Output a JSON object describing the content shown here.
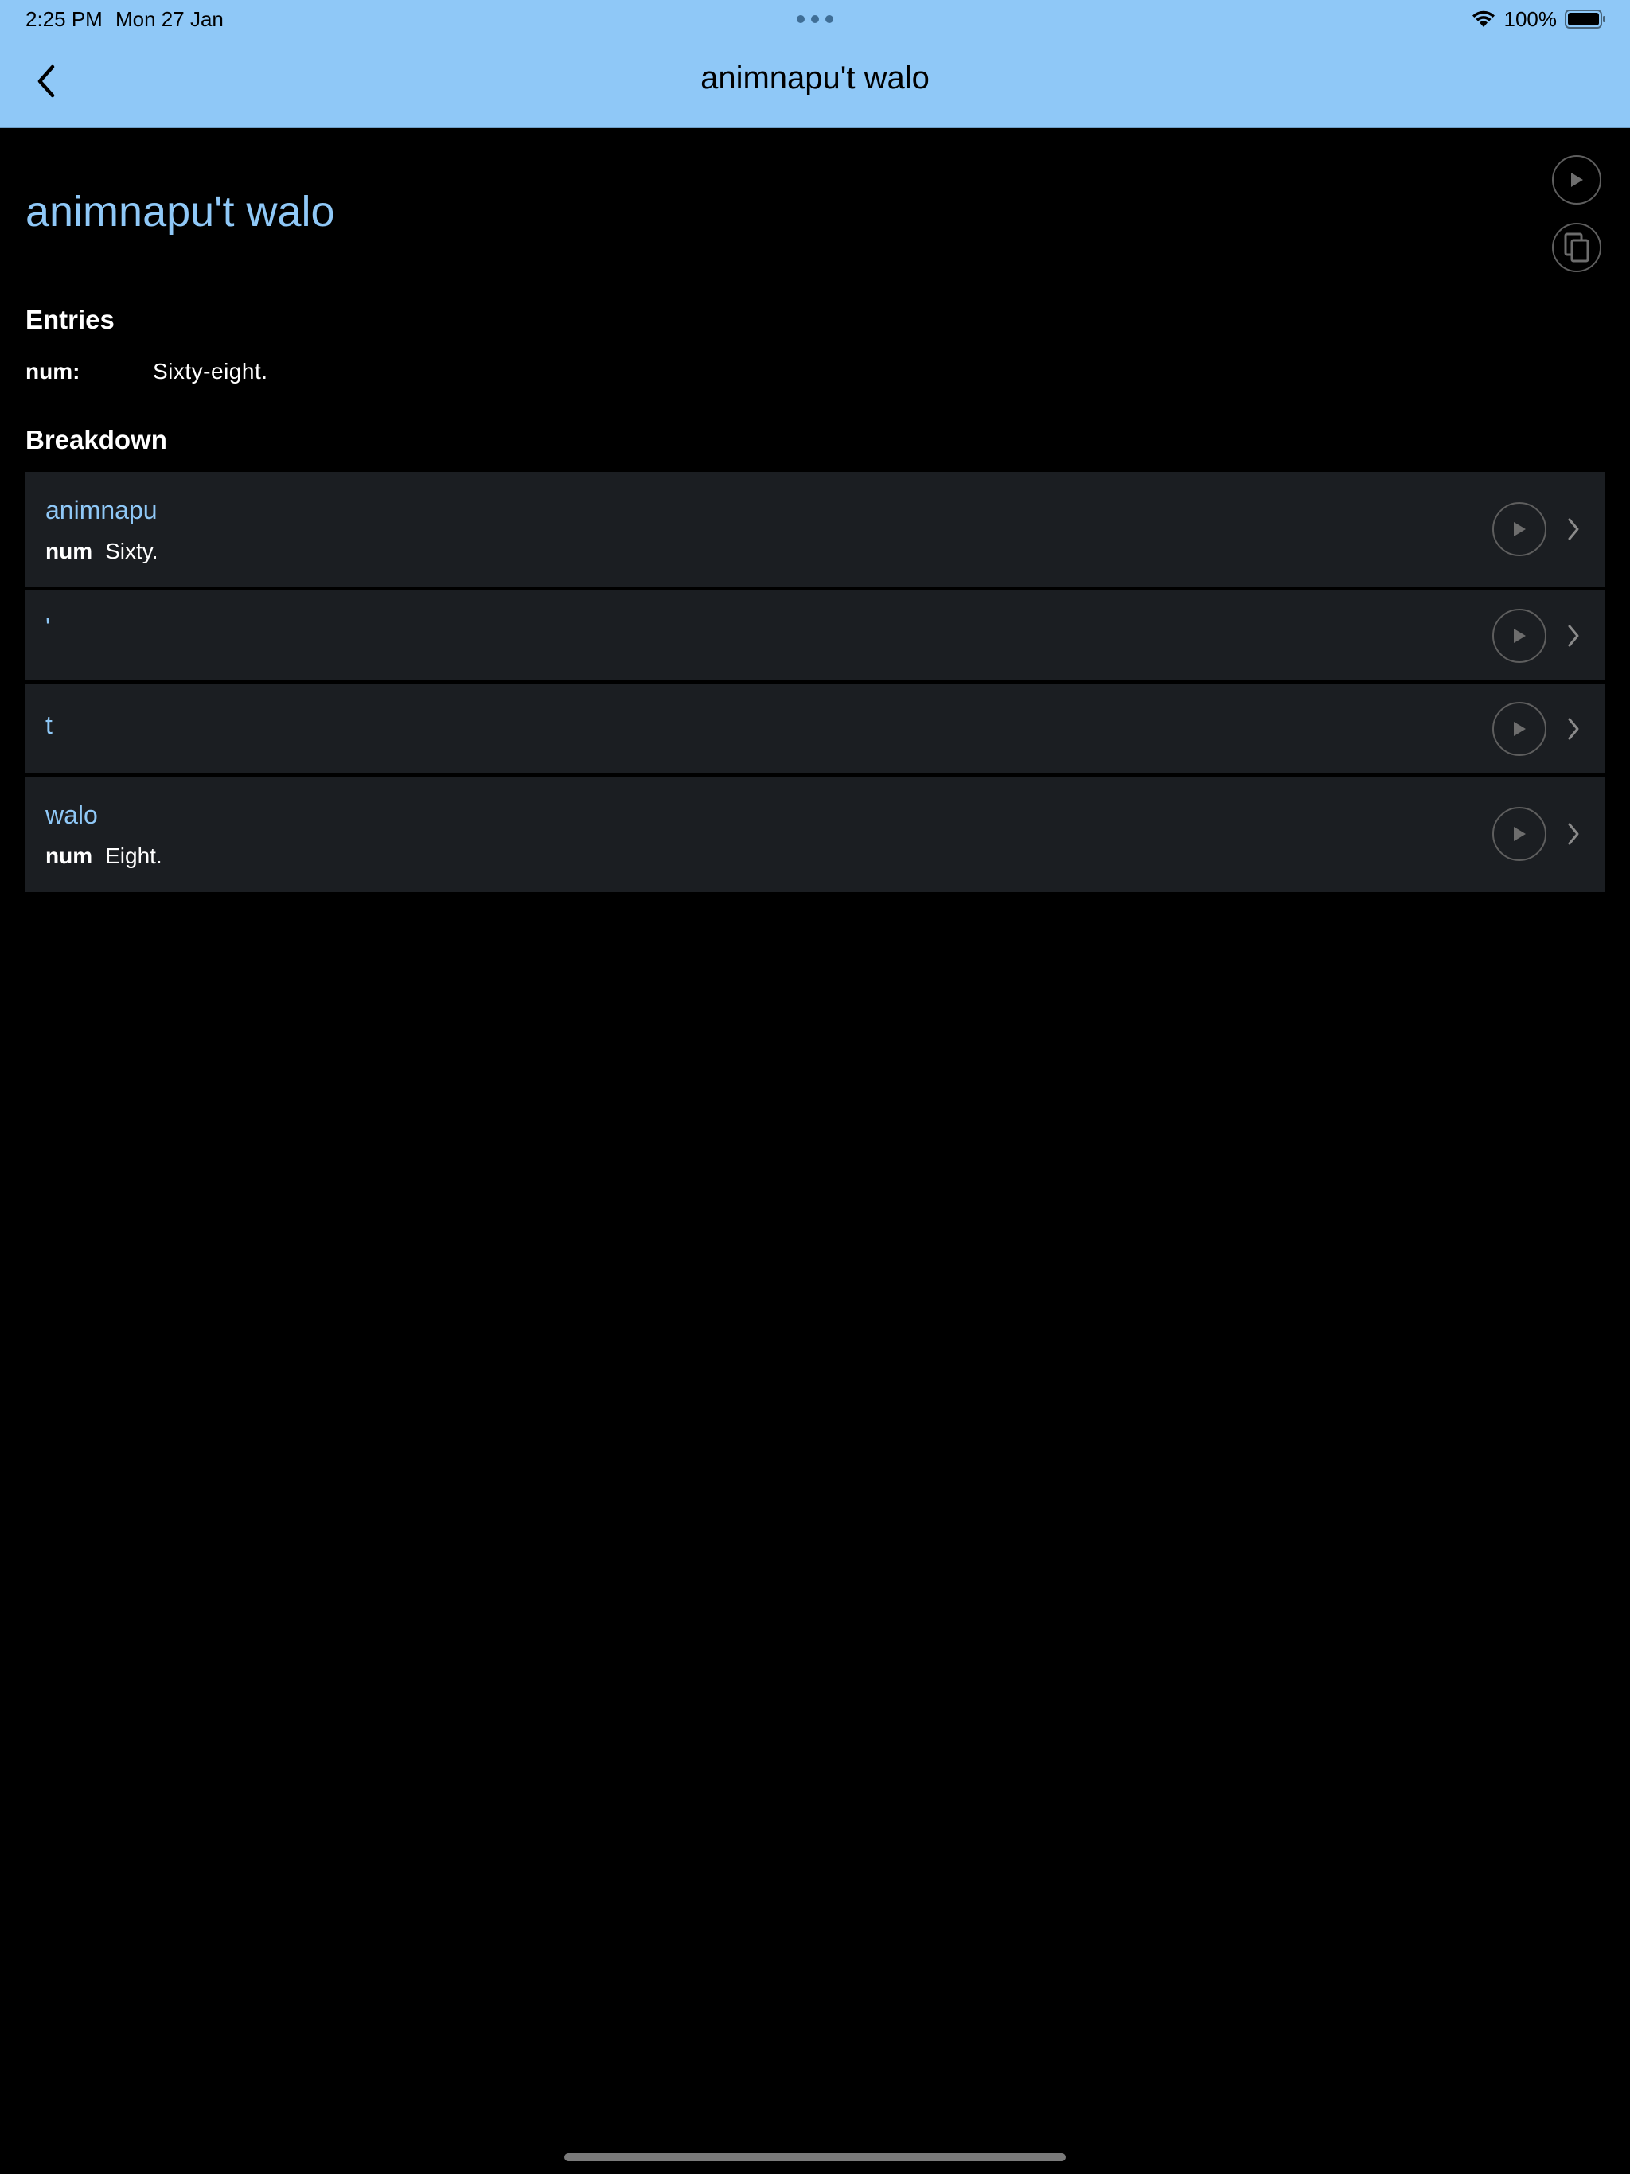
{
  "status_bar": {
    "time": "2:25 PM",
    "date": "Mon 27 Jan",
    "battery": "100%"
  },
  "nav": {
    "title": "animnapu't walo"
  },
  "word": {
    "title": "animnapu't walo"
  },
  "entries": {
    "heading": "Entries",
    "items": [
      {
        "pos": "num:",
        "definition": "Sixty-eight."
      }
    ]
  },
  "breakdown": {
    "heading": "Breakdown",
    "items": [
      {
        "word": "animnapu",
        "pos": "num",
        "definition": "Sixty."
      },
      {
        "word": "'"
      },
      {
        "word": "t"
      },
      {
        "word": "walo",
        "pos": "num",
        "definition": "Eight."
      }
    ]
  },
  "colors": {
    "bar_background": "#8fc8f7",
    "accent_text": "#8fc8f7",
    "row_background": "#1b1e22",
    "page_background": "#000000"
  }
}
